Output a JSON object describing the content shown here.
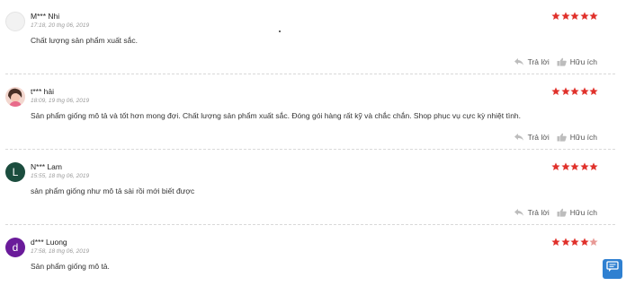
{
  "reviews": [
    {
      "name": "M*** Nhi",
      "time": "17:18, 20 thg 06, 2019",
      "text": "Chất lượng sản phẩm xuất sắc.",
      "rating": 5,
      "avatar": {
        "type": "blank",
        "letter": "",
        "color": "#f2f2f2"
      }
    },
    {
      "name": "t*** hải",
      "time": "18:09, 19 thg 06, 2019",
      "text": "Sản phẩm giống mô tả và tốt hơn mong đợi. Chất lượng sản phẩm xuất sắc. Đóng gói hàng rất kỹ và chắc chắn. Shop phục vụ cực kỳ nhiệt tình.",
      "rating": 5,
      "avatar": {
        "type": "photo",
        "letter": "",
        "color": "#f6d8d2"
      }
    },
    {
      "name": "N*** Lam",
      "time": "15:55, 18 thg 06, 2019",
      "text": "sản phẩm giống như mô tả sài rồi mới biết được",
      "rating": 5,
      "avatar": {
        "type": "letter",
        "letter": "L",
        "color": "#1b4d3e"
      }
    },
    {
      "name": "d*** Luong",
      "time": "17:58, 18 thg 06, 2019",
      "text": "Sản phẩm giống mô tả.",
      "rating": 4,
      "avatar": {
        "type": "letter",
        "letter": "d",
        "color": "#6a1b9a"
      }
    }
  ],
  "actions": {
    "reply_label": "Trả lời",
    "helpful_label": "Hữu ích"
  },
  "icons": {
    "reply": "reply-icon",
    "helpful": "thumbs-up-icon",
    "chat": "chat-icon"
  },
  "colors": {
    "star_full": "#e0312b",
    "star_half": "#e89a96",
    "star_empty": "#d6d6d6"
  }
}
